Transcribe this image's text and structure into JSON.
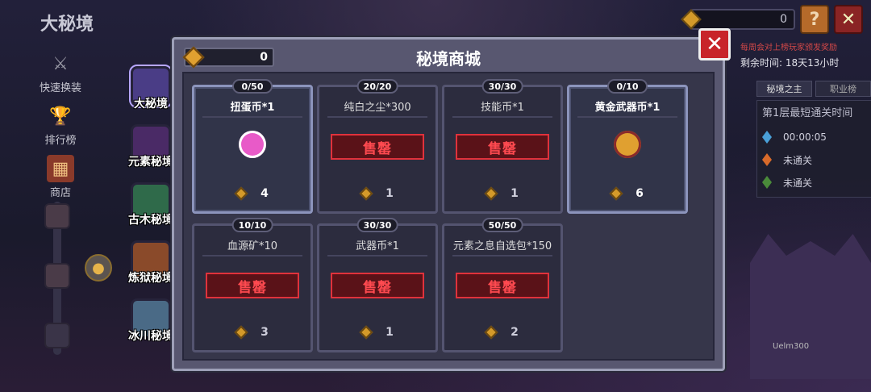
{
  "screen_title": "大秘境",
  "left_menu": [
    {
      "label": "快速换装",
      "icon": "armor-swap-icon"
    },
    {
      "label": "排行榜",
      "icon": "trophy-icon"
    },
    {
      "label": "商店",
      "icon": "shop-icon"
    }
  ],
  "dungeon_tabs": [
    {
      "label": "大秘境",
      "color": "#4a3d86",
      "active": true
    },
    {
      "label": "元素秘境",
      "color": "#4a2a66",
      "active": false
    },
    {
      "label": "古木秘境",
      "color": "#2f6a4a",
      "active": false
    },
    {
      "label": "炼狱秘境",
      "color": "#8a4a2a",
      "active": false
    },
    {
      "label": "冰川秘境",
      "color": "#4a6a86",
      "active": false
    }
  ],
  "top_bar": {
    "gem_count": "0",
    "help_label": "?",
    "close_label": "✕"
  },
  "event_info": {
    "notice": "每周会对上榜玩家颁发奖励",
    "remaining_label": "剩余时间: 18天13小时"
  },
  "rank_tabs": [
    "秘境之主",
    "职业榜"
  ],
  "rank_box": {
    "title": "第1层最短通关时间",
    "rows": [
      {
        "value": "00:00:05",
        "color": "#4aa0d8"
      },
      {
        "value": "未通关",
        "color": "#d86a2a"
      },
      {
        "value": "未通关",
        "color": "#4a8a3a"
      }
    ]
  },
  "character_name": "Uelm300",
  "shop": {
    "title": "秘境商城",
    "currency": "0",
    "close_label": "✕",
    "soldout_label": "售罄",
    "items": [
      {
        "stock": "0/50",
        "name": "扭蛋币*1",
        "price": "4",
        "sold_out": false,
        "icon_color": "#e85ac8"
      },
      {
        "stock": "20/20",
        "name": "纯白之尘*300",
        "price": "1",
        "sold_out": true,
        "icon_color": "#777"
      },
      {
        "stock": "30/30",
        "name": "技能币*1",
        "price": "1",
        "sold_out": true,
        "icon_color": "#777"
      },
      {
        "stock": "0/10",
        "name": "黄金武器币*1",
        "price": "6",
        "sold_out": false,
        "icon_color": "#e0a030"
      },
      {
        "stock": "10/10",
        "name": "血源矿*10",
        "price": "3",
        "sold_out": true,
        "icon_color": "#777"
      },
      {
        "stock": "30/30",
        "name": "武器币*1",
        "price": "1",
        "sold_out": true,
        "icon_color": "#777"
      },
      {
        "stock": "50/50",
        "name": "元素之息自选包*150",
        "price": "2",
        "sold_out": true,
        "icon_color": "#777"
      }
    ]
  }
}
